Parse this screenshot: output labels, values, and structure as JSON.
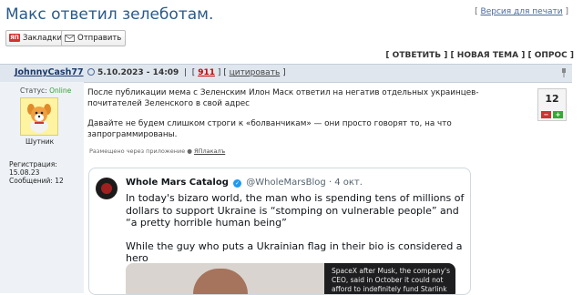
{
  "page": {
    "title": "Макс ответил зелеботам.",
    "print_link": "Версия для печати"
  },
  "share": {
    "bookmarks": "Закладки",
    "bookmarks_icon_text": "ЯП",
    "send": "Отправить"
  },
  "actions": {
    "reply": "ОТВЕТИТЬ",
    "new_topic": "НОВАЯ ТЕМА",
    "poll": "ОПРОС"
  },
  "post": {
    "author": "JohnnyCash77",
    "date": "5.10.2023 - 14:09",
    "number": "911",
    "quote_label": "цитировать",
    "status_label": "Статус:",
    "status_value": "Online",
    "avatar_caption": "Шутник",
    "registration": "Регистрация: 15.08.23",
    "messages": "Сообщений: 12",
    "body": [
      "После публикации мема с Зеленским Илон Маск ответил на негатив отдельных украинцев-почитателей Зеленского в свой адрес",
      "Давайте не будем слишком строги к «болванчикам» — они просто говорят то, на что запрограммированы."
    ],
    "posted_via_label": "Размещено через приложение",
    "posted_via_app": "ЯПлакалъ",
    "rating": "12",
    "vote_minus": "−",
    "vote_plus": "+"
  },
  "tweet": {
    "name": "Whole Mars Catalog",
    "verified_mark": "✓",
    "handle": "@WholeMarsBlog · 4 окт.",
    "text1": "In today's bizaro world, the man who is spending tens of millions of dollars to support Ukraine is “stomping on vulnerable people” and “a pretty horrible human being”",
    "text2": "While the guy who puts a Ukrainian flag in their bio is considered a hero",
    "media_text": "SpaceX after Musk, the company's CEO, said in October it could not afford to indefinitely fund Starlink in Ukraine, an"
  }
}
